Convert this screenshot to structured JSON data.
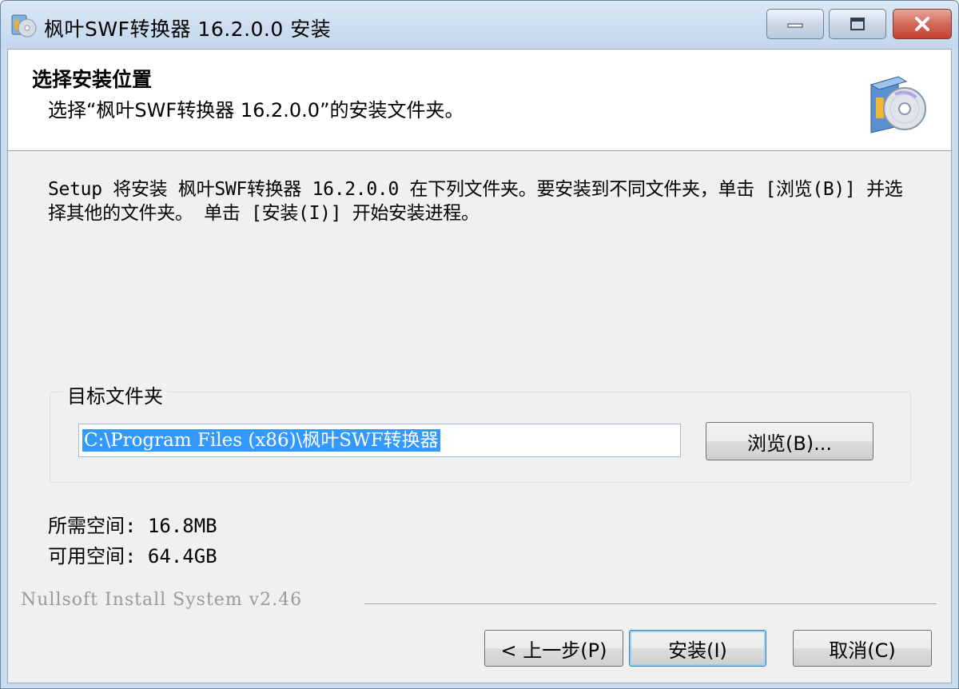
{
  "window": {
    "title": "枫叶SWF转换器 16.2.0.0 安装"
  },
  "header": {
    "title": "选择安装位置",
    "subtitle": "选择“枫叶SWF转换器 16.2.0.0”的安装文件夹。"
  },
  "intro_text": "Setup 将安装 枫叶SWF转换器 16.2.0.0 在下列文件夹。要安装到不同文件夹，单击 [浏览(B)] 并选择其他的文件夹。 单击 [安装(I)] 开始安装进程。",
  "destination": {
    "group_label": "目标文件夹",
    "path_value": "C:\\Program Files (x86)\\枫叶SWF转换器",
    "browse_label": "浏览(B)..."
  },
  "space": {
    "required": "所需空间: 16.8MB",
    "available": "可用空间: 64.4GB"
  },
  "brand": "Nullsoft Install System v2.46",
  "buttons": {
    "back": "< 上一步(P)",
    "install": "安装(I)",
    "cancel": "取消(C)"
  },
  "icons": {
    "app": "installer-cd-icon",
    "header": "installer-box-cd-icon",
    "minimize": "minimize-icon",
    "maximize": "maximize-icon",
    "close": "close-icon"
  }
}
